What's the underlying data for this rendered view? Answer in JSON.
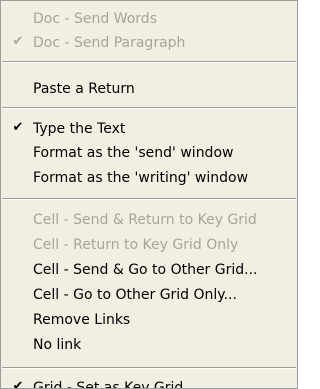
{
  "menu": {
    "items": [
      {
        "label": "Doc - Send Words",
        "checked": false,
        "enabled": false
      },
      {
        "label": "Doc - Send Paragraph",
        "checked": true,
        "enabled": false
      },
      {
        "label": "Paste a Return",
        "checked": false,
        "enabled": true
      },
      {
        "label": "Type the Text",
        "checked": true,
        "enabled": true
      },
      {
        "label": "Format as the 'send' window",
        "checked": false,
        "enabled": true
      },
      {
        "label": "Format as the 'writing' window",
        "checked": false,
        "enabled": true
      },
      {
        "label": "Cell - Send & Return to Key Grid",
        "checked": false,
        "enabled": false
      },
      {
        "label": "Cell - Return to Key Grid Only",
        "checked": false,
        "enabled": false
      },
      {
        "label": "Cell - Send & Go to Other Grid...",
        "checked": false,
        "enabled": true
      },
      {
        "label": "Cell - Go to Other Grid Only...",
        "checked": false,
        "enabled": true
      },
      {
        "label": "Remove Links",
        "checked": false,
        "enabled": true
      },
      {
        "label": "No link",
        "checked": false,
        "enabled": true
      },
      {
        "label": "Grid - Set as Key Grid",
        "checked": true,
        "enabled": true
      }
    ],
    "check_glyph": "✔",
    "colors": {
      "background": "#f1efe2",
      "enabled_text": "#000000",
      "disabled_text": "#a7a595",
      "separator": "#9d9d9d"
    }
  }
}
